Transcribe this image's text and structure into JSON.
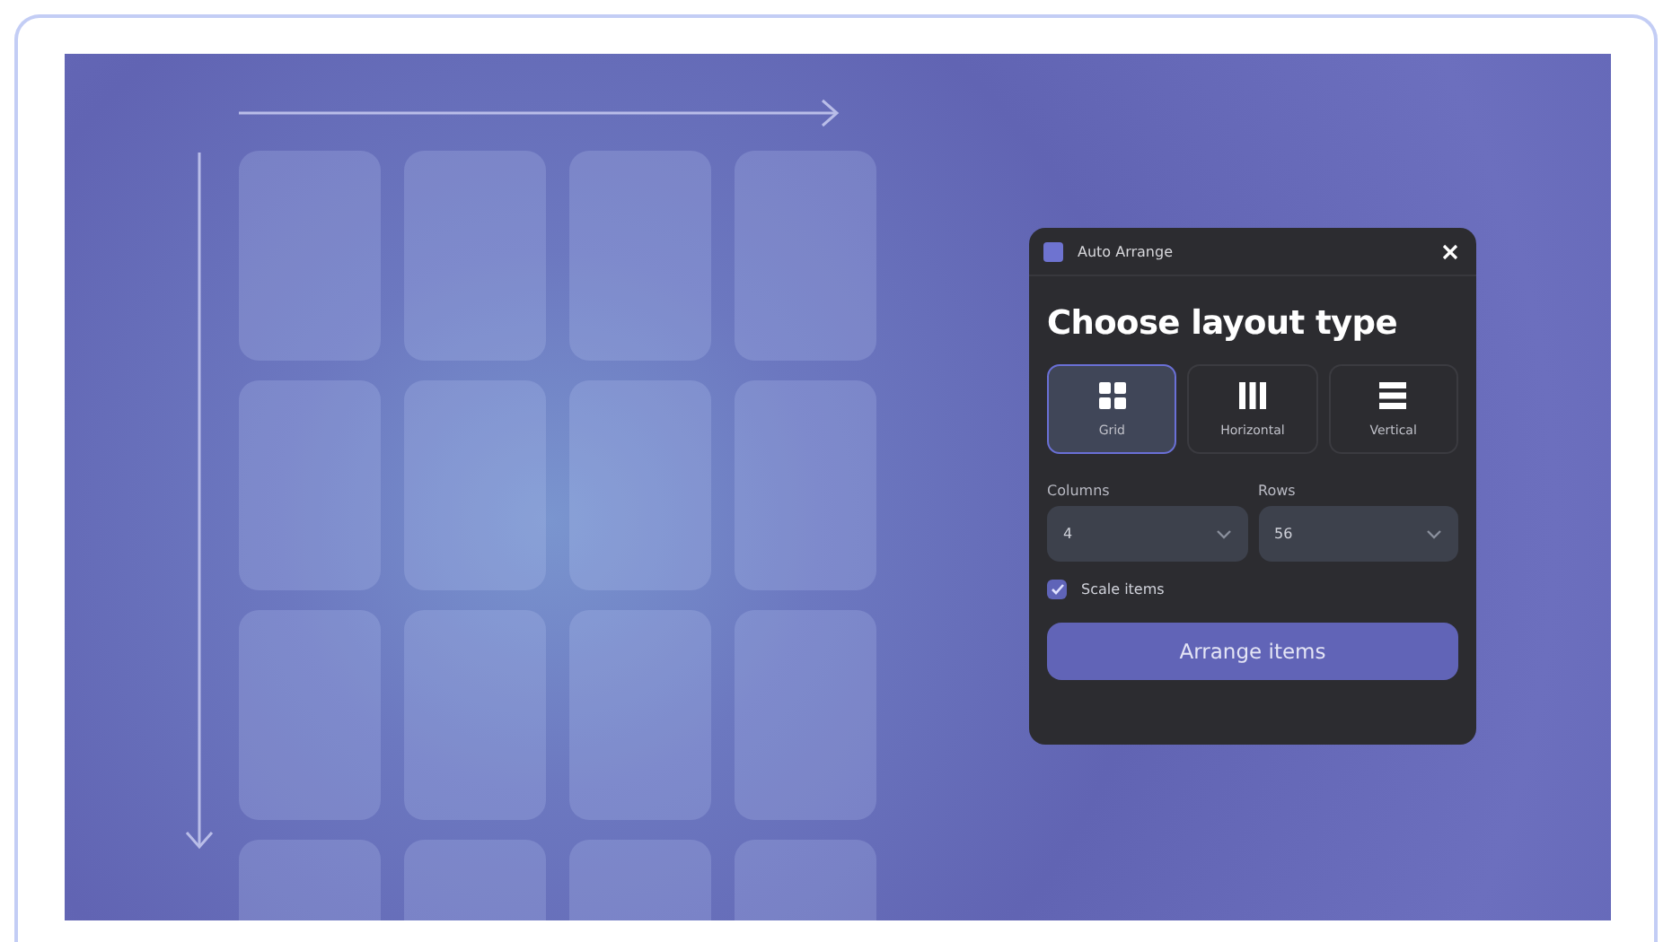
{
  "dialog": {
    "title": "Auto Arrange",
    "heading": "Choose layout type",
    "layouts": [
      {
        "kind": "grid",
        "label": "Grid",
        "selected": true
      },
      {
        "kind": "horizontal",
        "label": "Horizontal",
        "selected": false
      },
      {
        "kind": "vertical",
        "label": "Vertical",
        "selected": false
      }
    ],
    "fields": [
      {
        "label": "Columns",
        "value": "4"
      },
      {
        "label": "Rows",
        "value": "56"
      }
    ],
    "scale_items": {
      "label": "Scale items",
      "checked": true
    },
    "button": "Arrange items"
  }
}
